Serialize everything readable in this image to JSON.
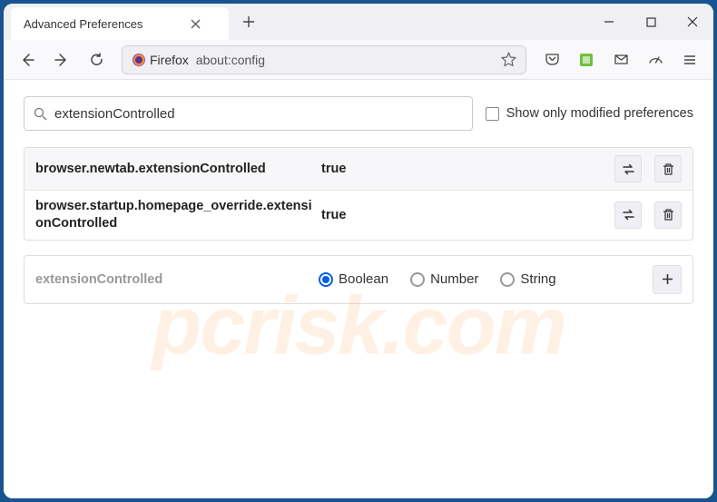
{
  "tab": {
    "title": "Advanced Preferences"
  },
  "urlbar": {
    "identity": "Firefox",
    "url": "about:config"
  },
  "search": {
    "value": "extensionControlled",
    "placeholder": ""
  },
  "filter": {
    "modified_only_label": "Show only modified preferences"
  },
  "prefs": [
    {
      "name": "browser.newtab.extensionControlled",
      "value": "true"
    },
    {
      "name": "browser.startup.homepage_override.extensionControlled",
      "value": "true"
    }
  ],
  "create": {
    "name": "extensionControlled",
    "types": {
      "boolean": "Boolean",
      "number": "Number",
      "string": "String"
    }
  },
  "watermark": "pcrisk.com"
}
